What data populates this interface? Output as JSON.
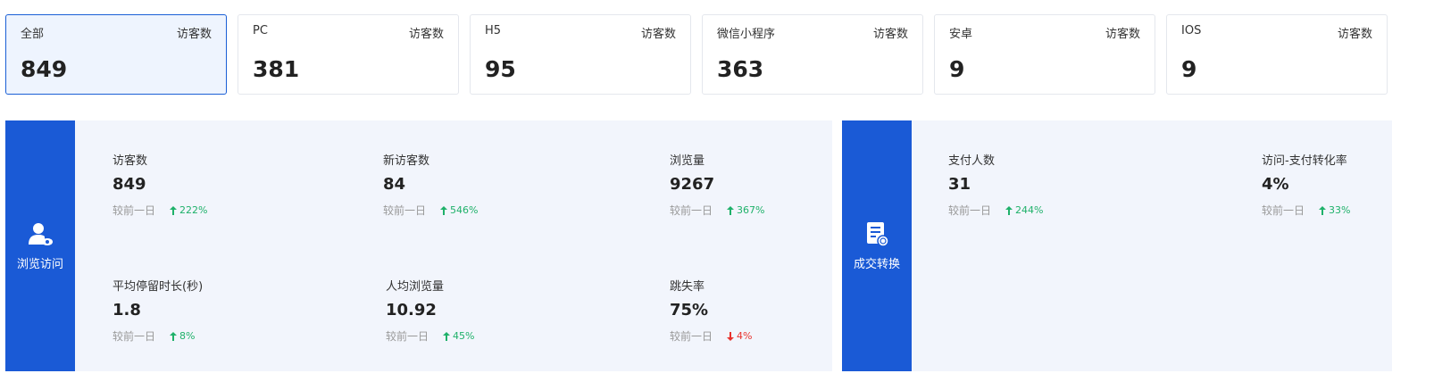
{
  "tabs": [
    {
      "name": "全部",
      "unit": "访客数",
      "value": "849"
    },
    {
      "name": "PC",
      "unit": "访客数",
      "value": "381"
    },
    {
      "name": "H5",
      "unit": "访客数",
      "value": "95"
    },
    {
      "name": "微信小程序",
      "unit": "访客数",
      "value": "363"
    },
    {
      "name": "安卓",
      "unit": "访客数",
      "value": "9"
    },
    {
      "name": "IOS",
      "unit": "访客数",
      "value": "9"
    }
  ],
  "browse": {
    "title": "浏览访问",
    "icon": "user-view-icon",
    "accent": "#1a5ad6",
    "metrics": [
      {
        "label": "访客数",
        "value": "849",
        "compare_label": "较前一日",
        "change": "222%",
        "direction": "up"
      },
      {
        "label": "新访客数",
        "value": "84",
        "compare_label": "较前一日",
        "change": "546%",
        "direction": "up"
      },
      {
        "label": "浏览量",
        "value": "9267",
        "compare_label": "较前一日",
        "change": "367%",
        "direction": "up"
      },
      {
        "label": "平均停留时长(秒)",
        "value": "1.8",
        "compare_label": "较前一日",
        "change": "8%",
        "direction": "up"
      },
      {
        "label": "人均浏览量",
        "value": "10.92",
        "compare_label": "较前一日",
        "change": "45%",
        "direction": "up"
      },
      {
        "label": "跳失率",
        "value": "75%",
        "compare_label": "较前一日",
        "change": "4%",
        "direction": "down"
      }
    ]
  },
  "deal": {
    "title": "成交转换",
    "icon": "order-document-icon",
    "accent": "#1a5ad6",
    "metrics": [
      {
        "label": "支付人数",
        "value": "31",
        "compare_label": "较前一日",
        "change": "244%",
        "direction": "up"
      },
      {
        "label": "访问-支付转化率",
        "value": "4%",
        "compare_label": "较前一日",
        "change": "33%",
        "direction": "up"
      }
    ]
  },
  "colors": {
    "up": "#1fb16a",
    "down": "#e8322d",
    "active_border": "#1a5fd6",
    "active_bg": "#eef4fe"
  }
}
